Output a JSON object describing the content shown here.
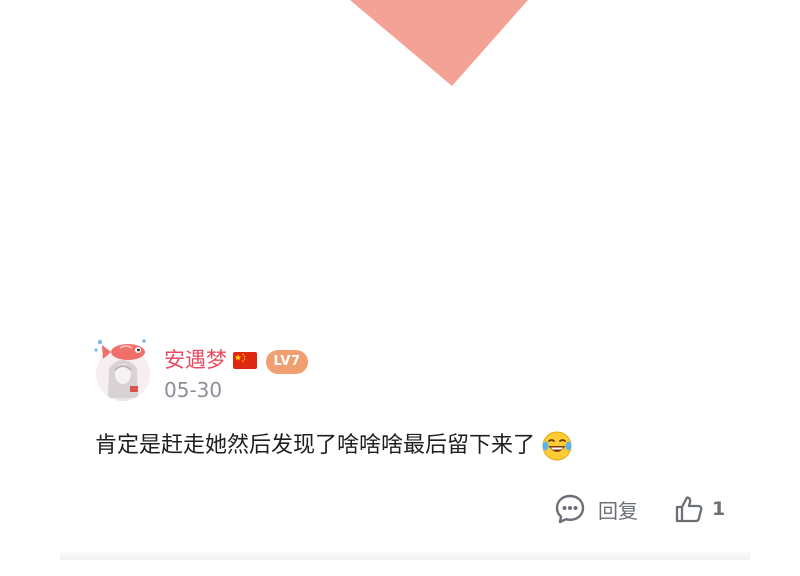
{
  "comment": {
    "username": "安遇梦",
    "level": "LV7",
    "date": "05-30",
    "text": "肯定是赶走她然后发现了啥啥啥最后留下来了",
    "emoji_icon": "laughing-tears-emoji",
    "flag_icon": "china-flag-icon"
  },
  "actions": {
    "reply_label": "回复",
    "like_count": "1",
    "reply_icon": "comment-bubble-icon",
    "like_icon": "thumbs-up-icon"
  },
  "colors": {
    "username": "#e84d62",
    "level_badge": "#f0a070",
    "top_shape": "#f4a295",
    "meta_text": "#8a8f99",
    "body_text": "#1d1f22"
  }
}
